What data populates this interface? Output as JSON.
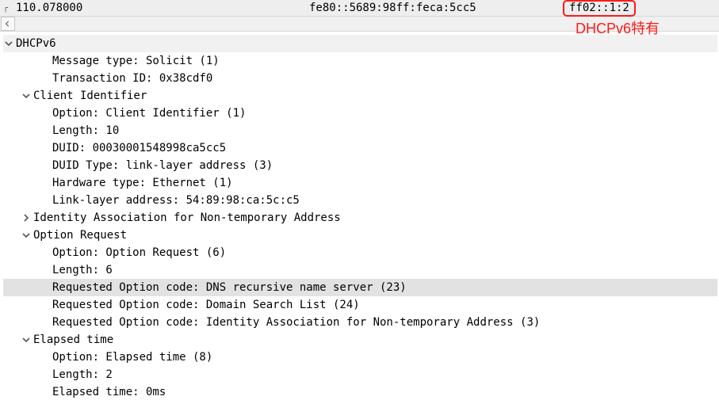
{
  "packet_list": {
    "time": "110.078000",
    "source": "fe80::5689:98ff:feca:5cc5",
    "destination": "ff02::1:2"
  },
  "annotation": "DHCPv6特有",
  "details": {
    "protocol": "DHCPv6",
    "message_type": "Message type: Solicit (1)",
    "transaction_id": "Transaction ID: 0x38cdf0",
    "client_id": {
      "label": "Client Identifier",
      "option": "Option: Client Identifier (1)",
      "length": "Length: 10",
      "duid": "DUID: 00030001548998ca5cc5",
      "duid_type": "DUID Type: link-layer address (3)",
      "hw_type": "Hardware type: Ethernet (1)",
      "ll_addr": "Link-layer address: 54:89:98:ca:5c:c5"
    },
    "iana": "Identity Association for Non-temporary Address",
    "opt_req": {
      "label": "Option Request",
      "option": "Option: Option Request (6)",
      "length": "Length: 6",
      "code1": "Requested Option code: DNS recursive name server (23)",
      "code2": "Requested Option code: Domain Search List (24)",
      "code3": "Requested Option code: Identity Association for Non-temporary Address (3)"
    },
    "elapsed": {
      "label": "Elapsed time",
      "option": "Option: Elapsed time (8)",
      "length": "Length: 2",
      "time": "Elapsed time: 0ms"
    }
  }
}
